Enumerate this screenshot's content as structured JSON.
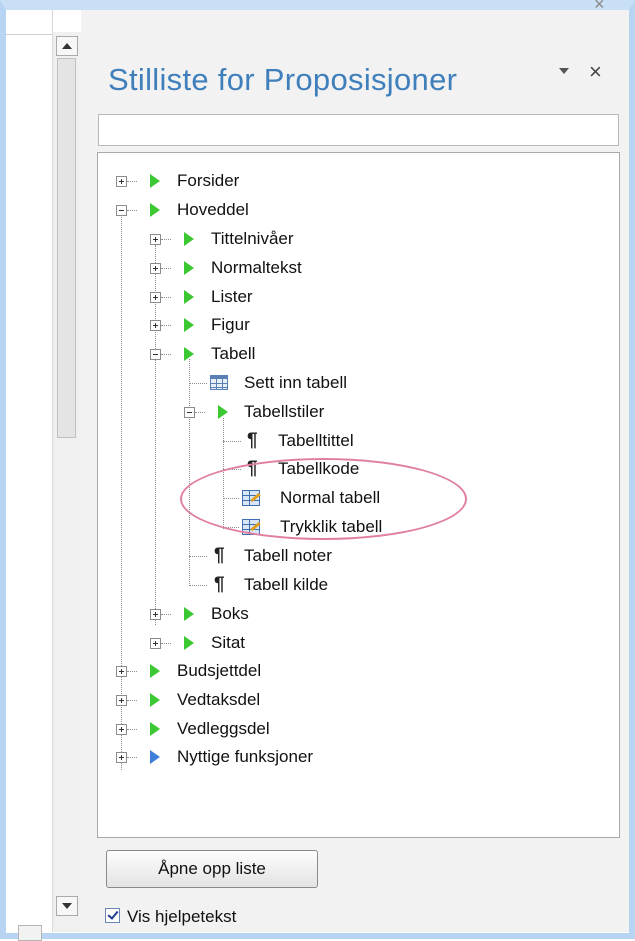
{
  "pane": {
    "title": "Stilliste for Proposisjoner",
    "search_value": "",
    "menu_icon": "chevron-down-icon",
    "close_icon": "×"
  },
  "tree": {
    "forsider": "Forsider",
    "hoveddel": "Hoveddel",
    "tittelnivaer": "Tittelnivåer",
    "normaltekst": "Normaltekst",
    "lister": "Lister",
    "figur": "Figur",
    "tabell": "Tabell",
    "sett_inn_tabell": "Sett inn tabell",
    "tabellstiler": "Tabellstiler",
    "tabelltittel": "Tabelltittel",
    "tabellkode": "Tabellkode",
    "normal_tabell": "Normal tabell",
    "trykklik_tabell": "Trykklik tabell",
    "tabell_noter": "Tabell noter",
    "tabell_kilde": "Tabell kilde",
    "boks": "Boks",
    "sitat": "Sitat",
    "budsjettdel": "Budsjettdel",
    "vedtaksdel": "Vedtaksdel",
    "vedleggsdel": "Vedleggsdel",
    "nyttige_funksjoner": "Nyttige funksjoner"
  },
  "footer": {
    "open_button": "Åpne opp liste",
    "show_help_label": "Vis hjelpetekst",
    "show_help_checked": true
  },
  "colors": {
    "title": "#3f7fbc",
    "style_marker": "#3cc832",
    "function_marker": "#3f7fd8",
    "highlight_ellipse": "#e07fa0"
  }
}
